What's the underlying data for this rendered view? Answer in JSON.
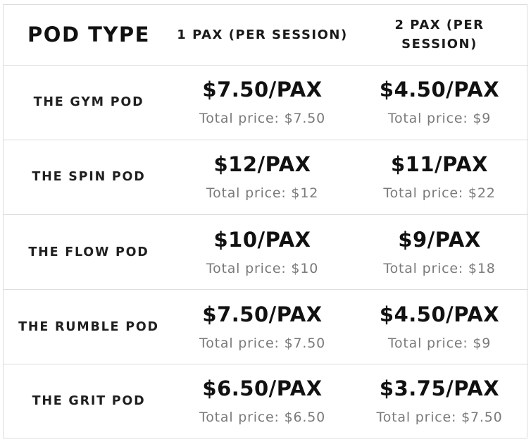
{
  "header": {
    "pod_type": "POD TYPE",
    "pax1": "1 PAX (PER SESSION)",
    "pax2": "2 PAX (PER SESSION)"
  },
  "rows": [
    {
      "name": "THE GYM POD",
      "pax1_price": "$7.50/PAX",
      "pax1_total": "Total price: $7.50",
      "pax2_price": "$4.50/PAX",
      "pax2_total": "Total price: $9"
    },
    {
      "name": "THE SPIN POD",
      "pax1_price": "$12/PAX",
      "pax1_total": "Total price: $12",
      "pax2_price": "$11/PAX",
      "pax2_total": "Total price: $22"
    },
    {
      "name": "THE FLOW POD",
      "pax1_price": "$10/PAX",
      "pax1_total": "Total price: $10",
      "pax2_price": "$9/PAX",
      "pax2_total": "Total price: $18"
    },
    {
      "name": "THE RUMBLE POD",
      "pax1_price": "$7.50/PAX",
      "pax1_total": "Total price: $7.50",
      "pax2_price": "$4.50/PAX",
      "pax2_total": "Total price: $9"
    },
    {
      "name": "THE GRIT POD",
      "pax1_price": "$6.50/PAX",
      "pax1_total": "Total price: $6.50",
      "pax2_price": "$3.75/PAX",
      "pax2_total": "Total price: $7.50"
    }
  ]
}
